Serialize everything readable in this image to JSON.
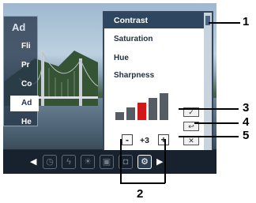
{
  "left_menu": {
    "title": "Ad",
    "items": [
      "Fli",
      "Pr",
      "Co",
      "Ad",
      "He"
    ],
    "active_index": 3
  },
  "panel": {
    "header": "Contrast",
    "options": [
      "Saturation",
      "Hue",
      "Sharpness"
    ],
    "value": "+3",
    "minus_label": "-",
    "plus_label": "+",
    "level_count": 5,
    "selected_level": 3
  },
  "toolbar": {
    "icons": [
      "timer-icon",
      "flash-icon",
      "brightness-icon",
      "resolution-icon",
      "camera-mode-icon",
      "settings-icon"
    ],
    "active_index": 5
  },
  "callouts": {
    "c1": "1",
    "c2": "2",
    "c3": "3",
    "c4": "4",
    "c5": "5"
  }
}
